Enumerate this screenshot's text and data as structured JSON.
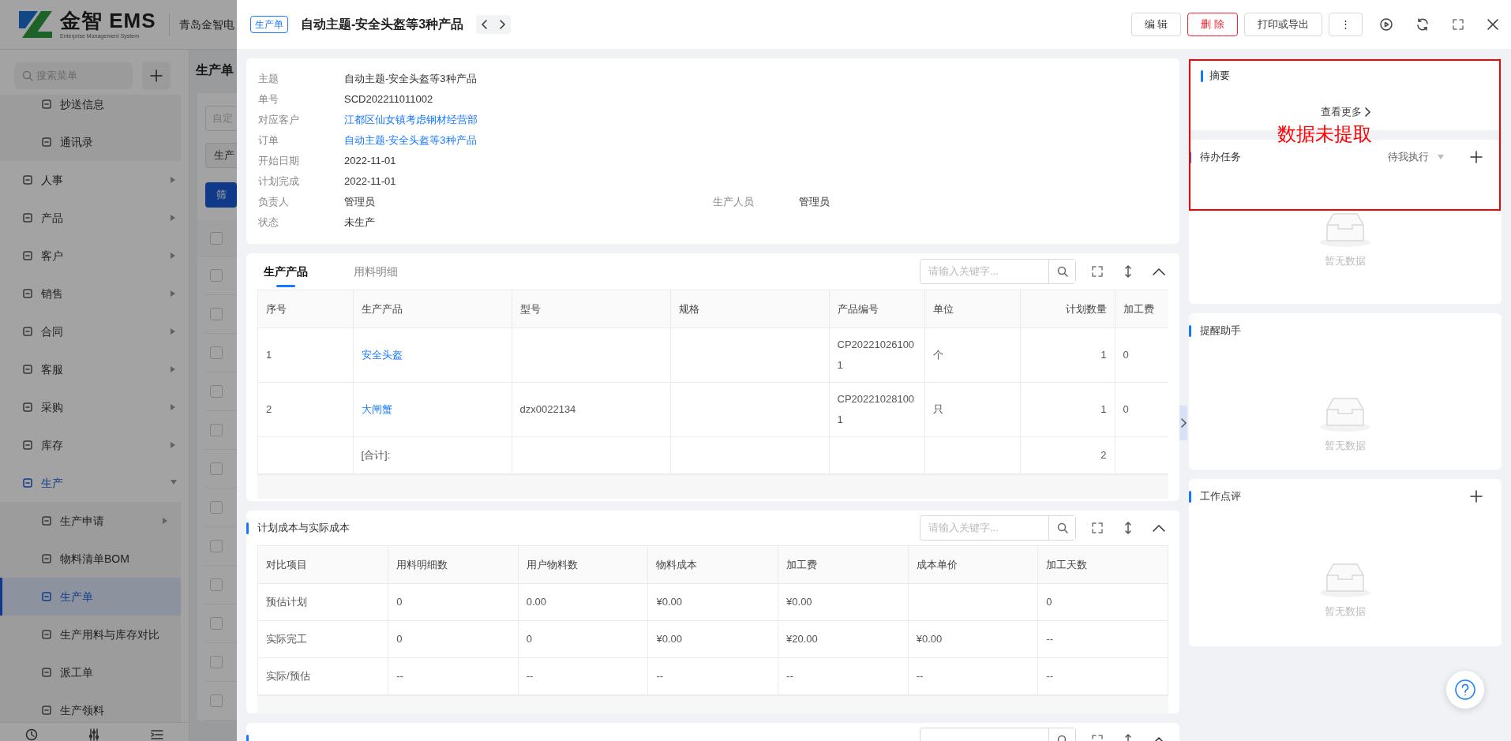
{
  "app": {
    "logo": {
      "brand": "金智 EMS",
      "tagline": "Enterprise Management System"
    },
    "company": "青岛金智电",
    "menu_search": {
      "placeholder": "搜索菜单"
    },
    "sidebar": {
      "items": [
        {
          "label": "抄送信息",
          "kind": "sub",
          "selected": false
        },
        {
          "label": "通讯录",
          "kind": "sub",
          "selected": false
        },
        {
          "label": "人事",
          "kind": "group",
          "expanded": false
        },
        {
          "label": "产品",
          "kind": "group",
          "expanded": false
        },
        {
          "label": "客户",
          "kind": "group",
          "expanded": false
        },
        {
          "label": "销售",
          "kind": "group",
          "expanded": false
        },
        {
          "label": "合同",
          "kind": "group",
          "expanded": false
        },
        {
          "label": "客服",
          "kind": "group",
          "expanded": false
        },
        {
          "label": "采购",
          "kind": "group",
          "expanded": false
        },
        {
          "label": "库存",
          "kind": "group",
          "expanded": false
        },
        {
          "label": "生产",
          "kind": "group",
          "expanded": true,
          "children": [
            {
              "label": "生产申请",
              "has_children": true,
              "selected": false
            },
            {
              "label": "物料清单BOM",
              "has_children": false,
              "selected": false
            },
            {
              "label": "生产单",
              "has_children": false,
              "selected": true
            },
            {
              "label": "生产用料与库存对比",
              "has_children": false,
              "selected": false
            },
            {
              "label": "派工单",
              "has_children": false,
              "selected": false
            },
            {
              "label": "生产领料",
              "has_children": false,
              "selected": false
            }
          ]
        }
      ]
    },
    "page_title": "生产单",
    "filter": {
      "placeholder": "自定"
    },
    "type_select": {
      "value": "生产"
    },
    "filter_button": "筛",
    "list_rows": [
      {
        "checked": false
      },
      {
        "checked": false
      },
      {
        "checked": false
      },
      {
        "checked": false
      },
      {
        "checked": false
      },
      {
        "checked": false
      },
      {
        "checked": false
      },
      {
        "checked": false
      },
      {
        "checked": false
      },
      {
        "checked": false
      },
      {
        "checked": false
      },
      {
        "checked": false
      },
      {
        "checked": false
      }
    ]
  },
  "drawer": {
    "tag": "生产单",
    "title": "自动主题-安全头盔等3种产品",
    "actions": [
      {
        "label": "编 辑",
        "kind": "default"
      },
      {
        "label": "删 除",
        "kind": "danger"
      },
      {
        "label": "打印或导出",
        "kind": "default"
      },
      {
        "label": "⋮",
        "kind": "more"
      }
    ]
  },
  "info": {
    "rows": [
      {
        "fields": [
          {
            "label": "主题",
            "value": "自动主题-安全头盔等3种产品",
            "link": false
          }
        ]
      },
      {
        "fields": [
          {
            "label": "单号",
            "value": "SCD202211011002",
            "link": false
          }
        ]
      },
      {
        "fields": [
          {
            "label": "对应客户",
            "value": "江都区仙女镇考虑钢材经营部",
            "link": true
          }
        ]
      },
      {
        "fields": [
          {
            "label": "订单",
            "value": "自动主题-安全头盔等3种产品",
            "link": true
          }
        ]
      },
      {
        "fields": [
          {
            "label": "开始日期",
            "value": "2022-11-01",
            "link": false
          }
        ]
      },
      {
        "fields": [
          {
            "label": "计划完成",
            "value": "2022-11-01",
            "link": false
          }
        ]
      },
      {
        "fields": [
          {
            "label": "负责人",
            "value": "管理员",
            "link": false
          },
          {
            "label": "生产人员",
            "value": "管理员",
            "link": false
          }
        ]
      },
      {
        "fields": [
          {
            "label": "状态",
            "value": "未生产",
            "link": false
          }
        ]
      }
    ]
  },
  "products": {
    "tabs": [
      {
        "label": "生产产品",
        "selected": true
      },
      {
        "label": "用料明细",
        "selected": false
      }
    ],
    "search": {
      "placeholder": "请输入关键字..."
    },
    "columns": [
      "序号",
      "生产产品",
      "型号",
      "规格",
      "产品编号",
      "单位",
      "计划数量",
      "加工费"
    ],
    "rows": [
      {
        "kind": "item",
        "no": "1",
        "product": "安全头盔",
        "code": "CP202210261001",
        "unit": "个",
        "qty": "1",
        "fee": "0"
      },
      {
        "kind": "item",
        "no": "2",
        "product": "大闸蟹",
        "model": "dzx0022134",
        "code": "CP202210281001",
        "unit": "只",
        "qty": "1",
        "fee": "0"
      },
      {
        "kind": "total",
        "product": "[合计]:",
        "qty": "2"
      }
    ]
  },
  "costs": {
    "title": "计划成本与实际成本",
    "search": {
      "placeholder": "请输入关键字..."
    },
    "columns": [
      "对比项目",
      "用料明细数",
      "用户物料数",
      "物料成本",
      "加工费",
      "成本单价",
      "加工天数"
    ],
    "rows": [
      {
        "item": "预估计划",
        "details": "0",
        "user_material": "0.00",
        "material_cost": "¥0.00",
        "labor": "¥0.00",
        "days": "0"
      },
      {
        "item": "实际完工",
        "details": "0",
        "user_material": "0",
        "material_cost": "¥0.00",
        "labor": "¥20.00",
        "unit_cost": "¥0.00",
        "days": "--"
      },
      {
        "item": "实际/预估",
        "details": "--",
        "user_material": "--",
        "material_cost": "--",
        "labor": "--",
        "unit_cost": "--",
        "days": "--"
      }
    ]
  },
  "side": {
    "summary": {
      "title": "摘要",
      "more": "查看更多"
    },
    "tasks": {
      "title": "待办任务",
      "filter": "待我执行",
      "empty": "暂无数据"
    },
    "reminders": {
      "title": "提醒助手",
      "empty": "暂无数据"
    },
    "reviews": {
      "title": "工作点评",
      "empty": "暂无数据"
    }
  },
  "annotation": {
    "text": "数据未提取"
  }
}
